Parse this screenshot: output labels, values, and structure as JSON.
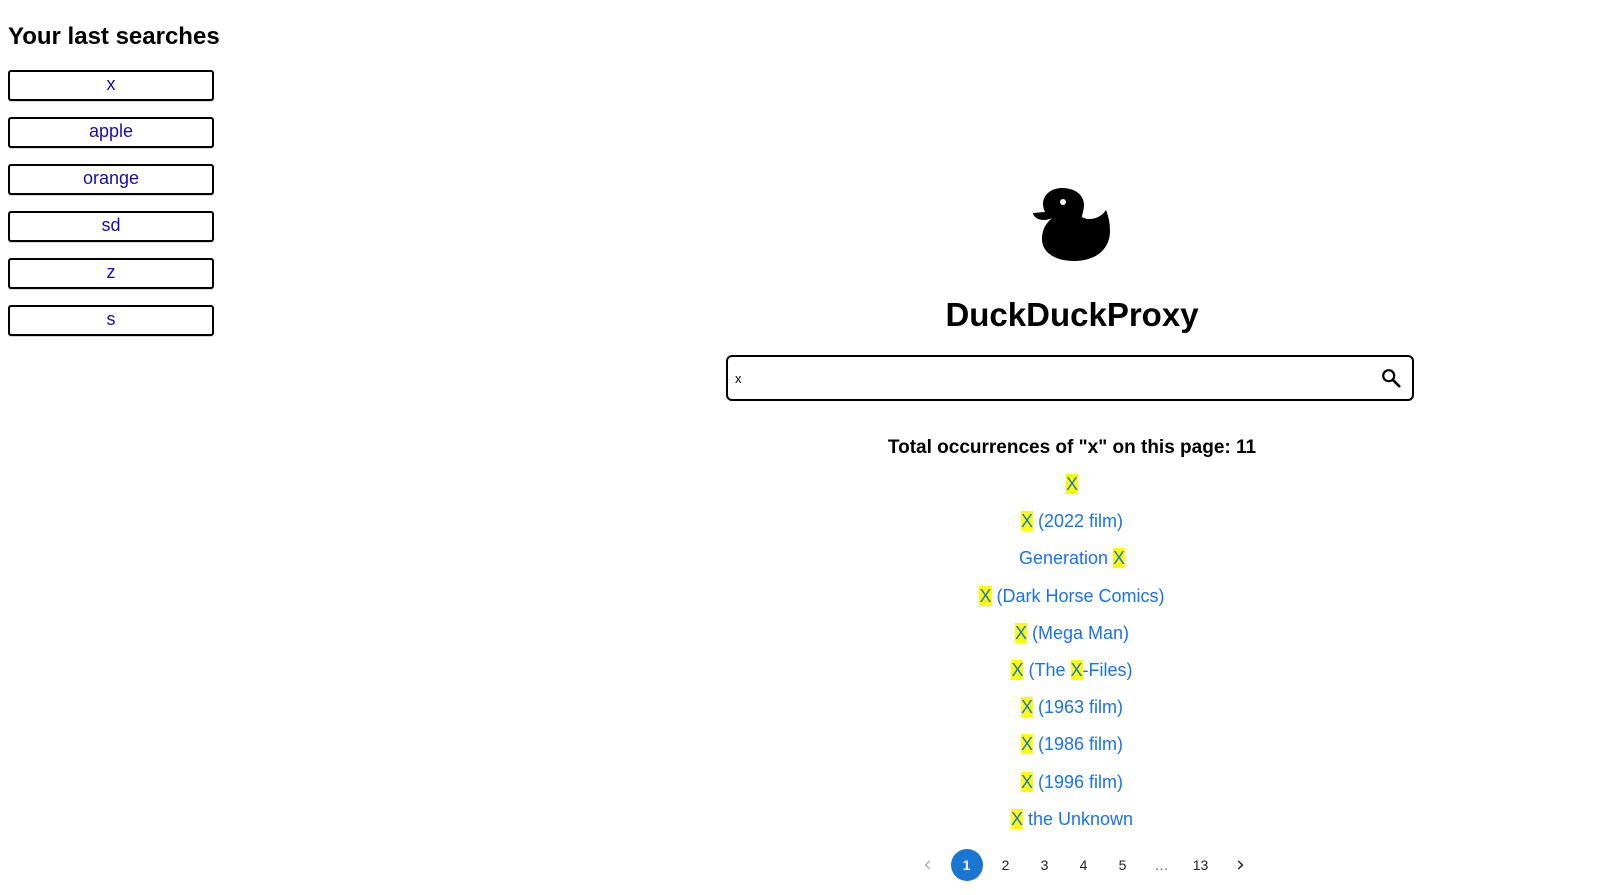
{
  "sidebar": {
    "heading": "Your last searches",
    "items": [
      {
        "label": "x"
      },
      {
        "label": "apple"
      },
      {
        "label": "orange"
      },
      {
        "label": "sd"
      },
      {
        "label": "z"
      },
      {
        "label": "s"
      }
    ]
  },
  "app": {
    "title": "DuckDuckProxy",
    "logo_icon": "duck-icon"
  },
  "search": {
    "value": "x",
    "button_icon": "search-icon"
  },
  "results": {
    "occurrences_text": "Total occurrences of \"x\" on this page: 11",
    "highlight_color": "#ffff00",
    "link_color": "#1a73e8",
    "items": [
      {
        "parts": [
          {
            "t": "X",
            "hl": true
          }
        ]
      },
      {
        "parts": [
          {
            "t": "X",
            "hl": true
          },
          {
            "t": " (2022 film)",
            "hl": false
          }
        ]
      },
      {
        "parts": [
          {
            "t": "Generation ",
            "hl": false
          },
          {
            "t": "X",
            "hl": true
          }
        ]
      },
      {
        "parts": [
          {
            "t": "X",
            "hl": true
          },
          {
            "t": " (Dark Horse Comics)",
            "hl": false
          }
        ]
      },
      {
        "parts": [
          {
            "t": "X",
            "hl": true
          },
          {
            "t": " (Mega Man)",
            "hl": false
          }
        ]
      },
      {
        "parts": [
          {
            "t": "X",
            "hl": true
          },
          {
            "t": " (The ",
            "hl": false
          },
          {
            "t": "X",
            "hl": true
          },
          {
            "t": "-Files)",
            "hl": false
          }
        ]
      },
      {
        "parts": [
          {
            "t": "X",
            "hl": true
          },
          {
            "t": " (1963 film)",
            "hl": false
          }
        ]
      },
      {
        "parts": [
          {
            "t": "X",
            "hl": true
          },
          {
            "t": " (1986 film)",
            "hl": false
          }
        ]
      },
      {
        "parts": [
          {
            "t": "X",
            "hl": true
          },
          {
            "t": " (1996 film)",
            "hl": false
          }
        ]
      },
      {
        "parts": [
          {
            "t": "X",
            "hl": true
          },
          {
            "t": " the Unknown",
            "hl": false
          }
        ]
      }
    ]
  },
  "pagination": {
    "prev_icon": "chevron-left-icon",
    "next_icon": "chevron-right-icon",
    "active_color": "#1976d2",
    "current": "1",
    "pages": [
      "1",
      "2",
      "3",
      "4",
      "5",
      "…",
      "13"
    ]
  }
}
